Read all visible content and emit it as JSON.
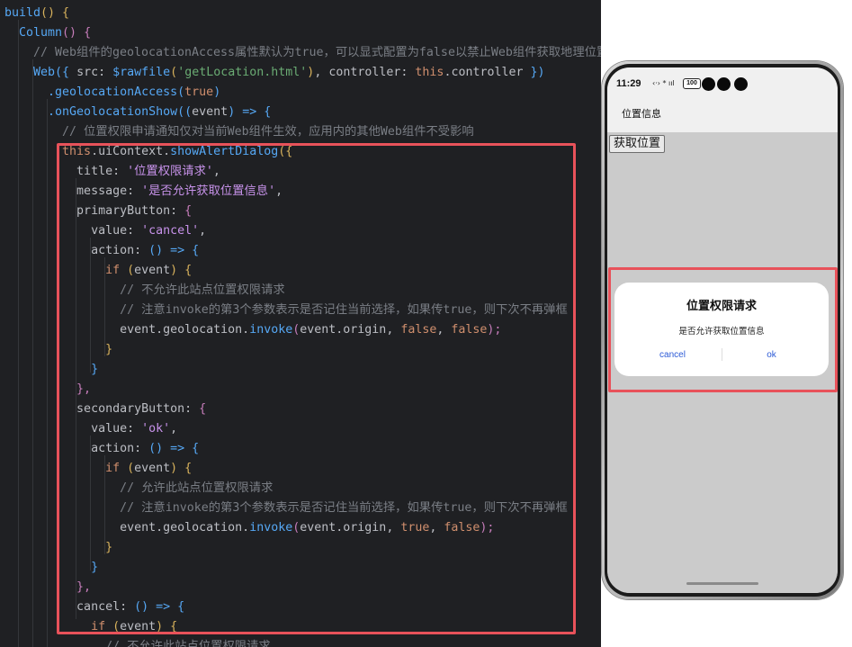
{
  "code": {
    "lines": [
      [
        [
          "build",
          "fn"
        ],
        [
          "() {",
          "paren1"
        ]
      ],
      [
        [
          "  Column",
          "fn"
        ],
        [
          "() {",
          "paren2"
        ]
      ],
      [
        [
          "    // Web组件的geolocationAccess属性默认为true，可以显式配置为false以禁止Web组件获取地理位置信息",
          "cm"
        ]
      ],
      [
        [
          "    Web",
          "fn"
        ],
        [
          "({ ",
          "paren3"
        ],
        [
          "src",
          "key"
        ],
        [
          ": ",
          "plain"
        ],
        [
          "$rawfile",
          "fn"
        ],
        [
          "(",
          "paren1"
        ],
        [
          "'getLocation.html'",
          "str"
        ],
        [
          ")",
          "paren1"
        ],
        [
          ", ",
          "plain"
        ],
        [
          "controller",
          "key"
        ],
        [
          ": ",
          "plain"
        ],
        [
          "this",
          "kw"
        ],
        [
          ".controller ",
          "plain"
        ],
        [
          "})",
          "paren3"
        ]
      ],
      [
        [
          "      .geolocationAccess",
          "fn"
        ],
        [
          "(",
          "paren3"
        ],
        [
          "true",
          "kw"
        ],
        [
          ")",
          "paren3"
        ]
      ],
      [
        [
          "      .onGeolocationShow",
          "fn"
        ],
        [
          "((",
          "paren3"
        ],
        [
          "event",
          "plain"
        ],
        [
          ") => {",
          "paren3"
        ]
      ],
      [
        [
          "        // 位置权限申请通知仅对当前Web组件生效，应用内的其他Web组件不受影响",
          "cm"
        ]
      ],
      [
        [
          "        this",
          "kw"
        ],
        [
          ".uiContext.",
          "plain"
        ],
        [
          "showAlertDialog",
          "fn"
        ],
        [
          "({",
          "paren1"
        ]
      ],
      [
        [
          "          title",
          "key"
        ],
        [
          ": ",
          "plain"
        ],
        [
          "'位置权限请求'",
          "strv"
        ],
        [
          ",",
          "plain"
        ]
      ],
      [
        [
          "          message",
          "key"
        ],
        [
          ": ",
          "plain"
        ],
        [
          "'是否允许获取位置信息'",
          "strv"
        ],
        [
          ",",
          "plain"
        ]
      ],
      [
        [
          "          primaryButton",
          "key"
        ],
        [
          ": ",
          "plain"
        ],
        [
          "{",
          "paren2"
        ]
      ],
      [
        [
          "            value",
          "key"
        ],
        [
          ": ",
          "plain"
        ],
        [
          "'cancel'",
          "strv"
        ],
        [
          ",",
          "plain"
        ]
      ],
      [
        [
          "            action",
          "key"
        ],
        [
          ": ",
          "plain"
        ],
        [
          "() => {",
          "paren3"
        ]
      ],
      [
        [
          "              if ",
          "kw"
        ],
        [
          "(",
          "paren1"
        ],
        [
          "event",
          "plain"
        ],
        [
          ") {",
          "paren1"
        ]
      ],
      [
        [
          "                // 不允许此站点位置权限请求",
          "cm"
        ]
      ],
      [
        [
          "                // 注意invoke的第3个参数表示是否记住当前选择，如果传true，则下次不再弹框",
          "cm"
        ]
      ],
      [
        [
          "                event.geolocation.",
          "plain"
        ],
        [
          "invoke",
          "fn"
        ],
        [
          "(",
          "paren2"
        ],
        [
          "event.origin, ",
          "plain"
        ],
        [
          "false",
          "kw"
        ],
        [
          ", ",
          "plain"
        ],
        [
          "false",
          "kw"
        ],
        [
          ");",
          "paren2"
        ]
      ],
      [
        [
          "              }",
          "paren1"
        ]
      ],
      [
        [
          "            }",
          "paren3"
        ]
      ],
      [
        [
          "          },",
          "paren2"
        ]
      ],
      [
        [
          "          secondaryButton",
          "key"
        ],
        [
          ": ",
          "plain"
        ],
        [
          "{",
          "paren2"
        ]
      ],
      [
        [
          "            value",
          "key"
        ],
        [
          ": ",
          "plain"
        ],
        [
          "'ok'",
          "strv"
        ],
        [
          ",",
          "plain"
        ]
      ],
      [
        [
          "            action",
          "key"
        ],
        [
          ": ",
          "plain"
        ],
        [
          "() => {",
          "paren3"
        ]
      ],
      [
        [
          "              if ",
          "kw"
        ],
        [
          "(",
          "paren1"
        ],
        [
          "event",
          "plain"
        ],
        [
          ") {",
          "paren1"
        ]
      ],
      [
        [
          "                // 允许此站点位置权限请求",
          "cm"
        ]
      ],
      [
        [
          "                // 注意invoke的第3个参数表示是否记住当前选择，如果传true，则下次不再弹框",
          "cm"
        ]
      ],
      [
        [
          "                event.geolocation.",
          "plain"
        ],
        [
          "invoke",
          "fn"
        ],
        [
          "(",
          "paren2"
        ],
        [
          "event.origin, ",
          "plain"
        ],
        [
          "true",
          "kw"
        ],
        [
          ", ",
          "plain"
        ],
        [
          "false",
          "kw"
        ],
        [
          ");",
          "paren2"
        ]
      ],
      [
        [
          "              }",
          "paren1"
        ]
      ],
      [
        [
          "            }",
          "paren3"
        ]
      ],
      [
        [
          "          },",
          "paren2"
        ]
      ],
      [
        [
          "          cancel",
          "key"
        ],
        [
          ": ",
          "plain"
        ],
        [
          "() => {",
          "paren3"
        ]
      ],
      [
        [
          "            if ",
          "kw"
        ],
        [
          "(",
          "paren1"
        ],
        [
          "event",
          "plain"
        ],
        [
          ") {",
          "paren1"
        ]
      ],
      [
        [
          "              // 不允许此站点位置权限请求",
          "cm"
        ]
      ]
    ]
  },
  "phone": {
    "status": {
      "time": "11:29",
      "icons": "‹·› * ııl",
      "battery": "100"
    },
    "app_title": "位置信息",
    "get_location_button": "获取位置",
    "dialog": {
      "title": "位置权限请求",
      "message": "是否允许获取位置信息",
      "primary_label": "cancel",
      "secondary_label": "ok"
    }
  },
  "colors": {
    "highlight": "#e8525a",
    "editor_bg": "#1f2023",
    "dialog_button": "#2c5ad6"
  }
}
